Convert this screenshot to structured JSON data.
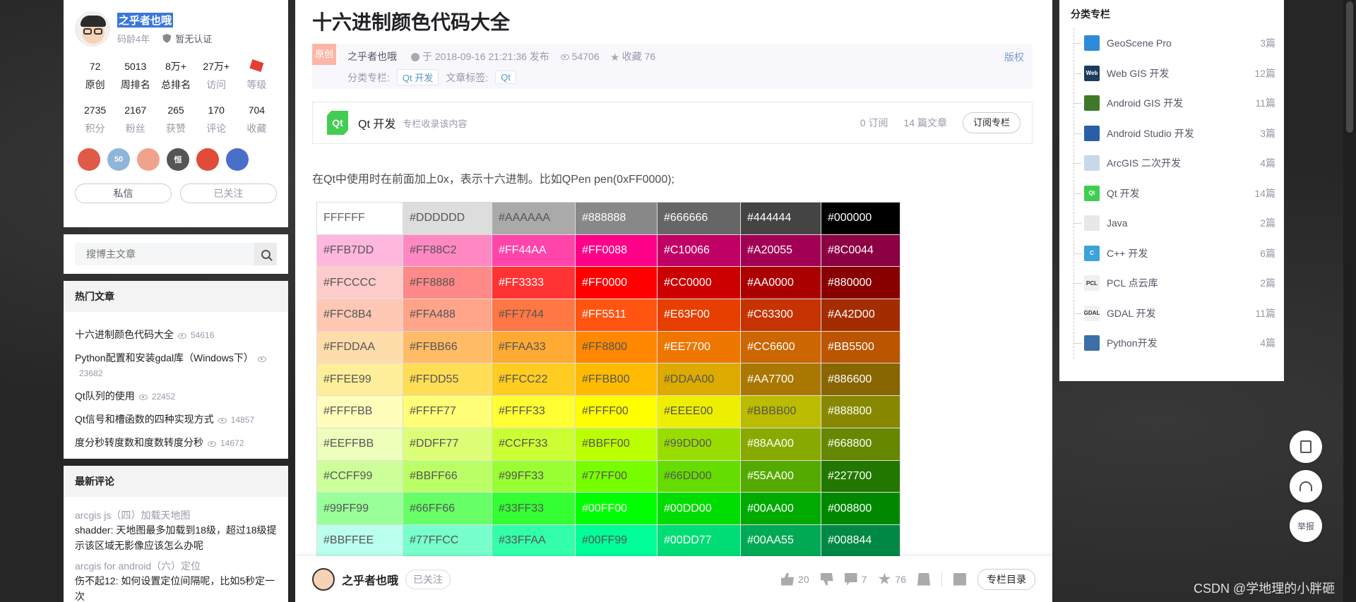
{
  "profile": {
    "name": "之乎者也哦",
    "code_age": "码龄4年",
    "auth": "暂无认证",
    "stats_row1": [
      {
        "num": "72",
        "label": "原创",
        "style": "strong"
      },
      {
        "num": "5013",
        "label": "周排名",
        "style": "strong"
      },
      {
        "num": "8万+",
        "label": "总排名",
        "style": "strong"
      },
      {
        "num": "27万+",
        "label": "访问",
        "style": "muted"
      },
      {
        "num": "",
        "label": "等级",
        "style": "muted"
      }
    ],
    "stats_row2": [
      {
        "num": "2735",
        "label": "积分"
      },
      {
        "num": "2167",
        "label": "粉丝"
      },
      {
        "num": "265",
        "label": "获赞"
      },
      {
        "num": "170",
        "label": "评论"
      },
      {
        "num": "704",
        "label": "收藏"
      }
    ],
    "badges": [
      {
        "text": "",
        "color": "#e05a47"
      },
      {
        "text": "50",
        "color": "#8fb5d9"
      },
      {
        "text": "",
        "color": "#f0a38b"
      },
      {
        "text": "恒",
        "color": "#555"
      },
      {
        "text": "",
        "color": "#e04b3a"
      },
      {
        "text": "",
        "color": "#4a6fc9"
      }
    ],
    "message_label": "私信",
    "followed_label": "已关注"
  },
  "search": {
    "placeholder": "搜博主文章"
  },
  "hot": {
    "title": "热门文章",
    "items": [
      {
        "title": "十六进制颜色代码大全",
        "views": "54616"
      },
      {
        "title": "Python配置和安装gdal库（Windows下）",
        "views": "23682"
      },
      {
        "title": "Qt队列的使用",
        "views": "22452"
      },
      {
        "title": "Qt信号和槽函数的四种实现方式",
        "views": "14857"
      },
      {
        "title": "度分秒转度数和度数转度分秒",
        "views": "14672"
      }
    ]
  },
  "comments": {
    "title": "最新评论",
    "items": [
      {
        "article": "arcgis js（四）加载天地图",
        "text": "shadder: 天地图最多加载到18级，超过18级提示该区域无影像应该怎么办呢"
      },
      {
        "article": "arcgis for android（六）定位",
        "text": "伤不起12: 如何设置定位间隔呢，比如5秒定一次"
      }
    ]
  },
  "article": {
    "title": "十六进制颜色代码大全",
    "tag": "原创",
    "author": "之乎者也哦",
    "date": "于 2018-09-16 21:21:36 发布",
    "views": "54706",
    "favorites": "收藏 76",
    "copyright": "版权",
    "category_label": "分类专栏:",
    "category": "Qt 开发",
    "tags_label": "文章标签:",
    "tag_item": "Qt",
    "paragraph": "在Qt中使用时在前面加上0x，表示十六进制。比如QPen pen(0xFF0000);"
  },
  "column": {
    "logo_text": "Qt",
    "name": "Qt 开发",
    "desc": "专栏收录该内容",
    "subs": "0 订阅",
    "count": "14 篇文章",
    "subscribe": "订阅专栏"
  },
  "color_table": [
    [
      "#FFFFFF",
      "#DDDDDD",
      "#AAAAAA",
      "#888888",
      "#666666",
      "#444444",
      "#000000"
    ],
    [
      "#FFB7DD",
      "#FF88C2",
      "#FF44AA",
      "#FF0088",
      "#C10066",
      "#A20055",
      "#8C0044"
    ],
    [
      "#FFCCCC",
      "#FF8888",
      "#FF3333",
      "#FF0000",
      "#CC0000",
      "#AA0000",
      "#880000"
    ],
    [
      "#FFC8B4",
      "#FFA488",
      "#FF7744",
      "#FF5511",
      "#E63F00",
      "#C63300",
      "#A42D00"
    ],
    [
      "#FFDDAA",
      "#FFBB66",
      "#FFAA33",
      "#FF8800",
      "#EE7700",
      "#CC6600",
      "#BB5500"
    ],
    [
      "#FFEE99",
      "#FFDD55",
      "#FFCC22",
      "#FFBB00",
      "#DDAA00",
      "#AA7700",
      "#886600"
    ],
    [
      "#FFFFBB",
      "#FFFF77",
      "#FFFF33",
      "#FFFF00",
      "#EEEE00",
      "#BBBB00",
      "#888800"
    ],
    [
      "#EEFFBB",
      "#DDFF77",
      "#CCFF33",
      "#BBFF00",
      "#99DD00",
      "#88AA00",
      "#668800"
    ],
    [
      "#CCFF99",
      "#BBFF66",
      "#99FF33",
      "#77FF00",
      "#66DD00",
      "#55AA00",
      "#227700"
    ],
    [
      "#99FF99",
      "#66FF66",
      "#33FF33",
      "#00FF00",
      "#00DD00",
      "#00AA00",
      "#008800"
    ],
    [
      "#BBFFEE",
      "#77FFCC",
      "#33FFAA",
      "#00FF99",
      "#00DD77",
      "#00AA55",
      "#008844"
    ]
  ],
  "color_table_cell_labels": [
    [
      "FFFFFF",
      "#DDDDDD",
      "#AAAAAA",
      "#888888",
      "#666666",
      "#444444",
      "#000000"
    ],
    [
      "#FFB7DD",
      "#FF88C2",
      "#FF44AA",
      "#FF0088",
      "#C10066",
      "#A20055",
      "#8C0044"
    ],
    [
      "#FFCCCC",
      "#FF8888",
      "#FF3333",
      "#FF0000",
      "#CC0000",
      "#AA0000",
      "#880000"
    ],
    [
      "#FFC8B4",
      "#FFA488",
      "#FF7744",
      "#FF5511",
      "#E63F00",
      "#C63300",
      "#A42D00"
    ],
    [
      "#FFDDAA",
      "#FFBB66",
      "#FFAA33",
      "#FF8800",
      "#EE7700",
      "#CC6600",
      "#BB5500"
    ],
    [
      "#FFEE99",
      "#FFDD55",
      "#FFCC22",
      "#FFBB00",
      "#DDAA00",
      "#AA7700",
      "#886600"
    ],
    [
      "#FFFFBB",
      "#FFFF77",
      "#FFFF33",
      "#FFFF00",
      "#EEEE00",
      "#BBBB00",
      "#888800"
    ],
    [
      "#EEFFBB",
      "#DDFF77",
      "#CCFF33",
      "#BBFF00",
      "#99DD00",
      "#88AA00",
      "#668800"
    ],
    [
      "#CCFF99",
      "#BBFF66",
      "#99FF33",
      "#77FF00",
      "#66DD00",
      "#55AA00",
      "#227700"
    ],
    [
      "#99FF99",
      "#66FF66",
      "#33FF33",
      "#00FF00",
      "#00DD00",
      "#00AA00",
      "#008800"
    ],
    [
      "#BBFFEE",
      "#77FFCC",
      "#33FFAA",
      "#00FF99",
      "#00DD77",
      "#00AA55",
      "#008844"
    ]
  ],
  "bottom": {
    "author": "之乎者也哦",
    "followed": "已关注",
    "likes": "20",
    "comments": "7",
    "favorites": "76",
    "toc": "专栏目录"
  },
  "right": {
    "title": "分类专栏",
    "items": [
      {
        "name": "GeoScene Pro",
        "count": "3篇",
        "icon": "geoscene-icon",
        "color": "#2e8bd8",
        "glyph": ""
      },
      {
        "name": "Web GIS 开发",
        "count": "12篇",
        "icon": "web-icon",
        "color": "#1a3d5c",
        "glyph": "Web"
      },
      {
        "name": "Android GIS 开发",
        "count": "11篇",
        "icon": "android-gis-icon",
        "color": "#3f7a2a",
        "glyph": ""
      },
      {
        "name": "Android Studio 开发",
        "count": "3篇",
        "icon": "android-studio-icon",
        "color": "#2a5fa8",
        "glyph": ""
      },
      {
        "name": "ArcGIS 二次开发",
        "count": "4篇",
        "icon": "arcgis-icon",
        "color": "#c8d8ea",
        "glyph": ""
      },
      {
        "name": "Qt 开发",
        "count": "14篇",
        "icon": "qt-icon",
        "color": "#41cd52",
        "glyph": "Qt"
      },
      {
        "name": "Java",
        "count": "2篇",
        "icon": "java-icon",
        "color": "#e8e8e8",
        "glyph": ""
      },
      {
        "name": "C++ 开发",
        "count": "6篇",
        "icon": "cpp-icon",
        "color": "#3ba3d9",
        "glyph": "C"
      },
      {
        "name": "PCL 点云库",
        "count": "2篇",
        "icon": "pcl-icon",
        "color": "#f0f0f0",
        "glyph": "PCL"
      },
      {
        "name": "GDAL 开发",
        "count": "11篇",
        "icon": "gdal-icon",
        "color": "#f0f0f0",
        "glyph": "GDAL"
      },
      {
        "name": "Python开发",
        "count": "4篇",
        "icon": "python-icon",
        "color": "#3a6fa8",
        "glyph": ""
      }
    ]
  },
  "tools": {
    "report": "举报"
  },
  "watermark": "CSDN @学地理的小胖砸"
}
